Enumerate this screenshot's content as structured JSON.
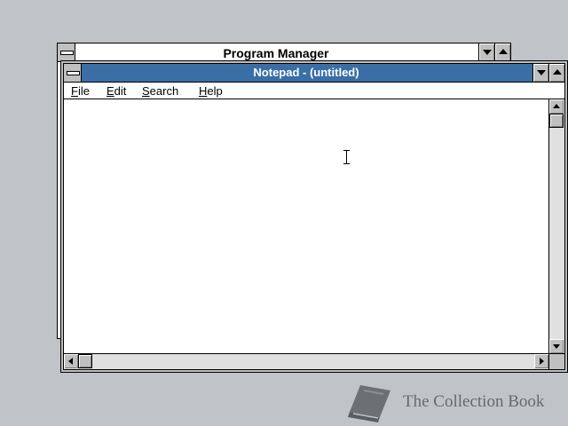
{
  "program_manager": {
    "title": "Program Manager",
    "icons": {
      "system_menu": "system-menu-icon",
      "minimize": "minimize-arrow-icon",
      "maximize": "maximize-arrow-icon"
    }
  },
  "notepad": {
    "title": "Notepad - (untitled)",
    "menu": [
      {
        "label": "File",
        "accel": "F",
        "rest": "ile"
      },
      {
        "label": "Edit",
        "accel": "E",
        "rest": "dit"
      },
      {
        "label": "Search",
        "accel": "S",
        "rest": "earch"
      },
      {
        "label": "Help",
        "accel": "H",
        "rest": "elp"
      }
    ],
    "content": "",
    "colors": {
      "titlebar": "#3a6ea5",
      "title_text": "#ffffff",
      "frame": "#c0c0c0"
    }
  },
  "watermark": {
    "text": "The Collection Book",
    "icon": "book-icon"
  },
  "desktop": {
    "background": "#c0c4c8"
  }
}
